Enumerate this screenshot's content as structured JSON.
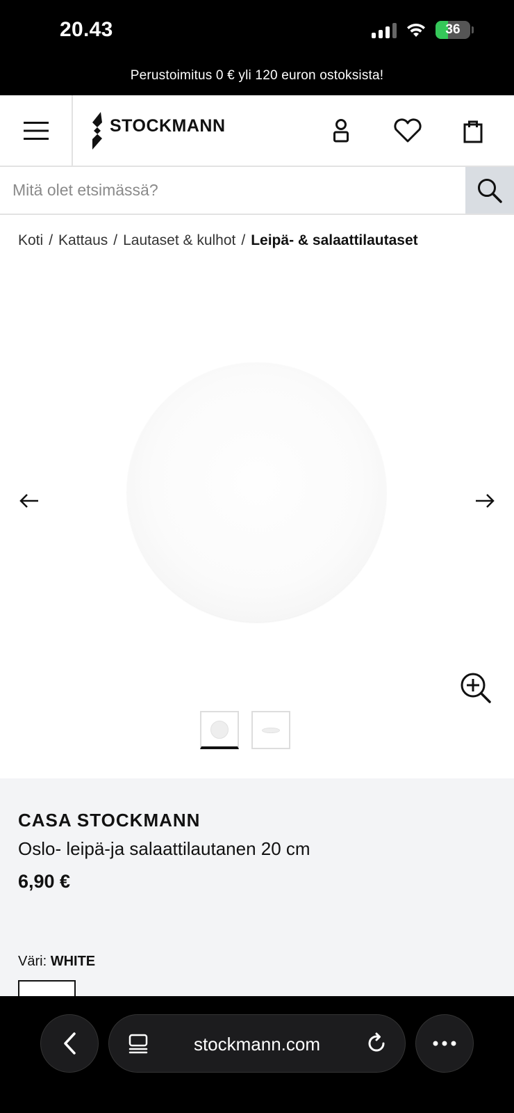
{
  "status_bar": {
    "time": "20.43",
    "battery": "36",
    "battery_level": 0.36
  },
  "promo": {
    "text": "Perustoimitus 0 € yli 120 euron ostoksista!"
  },
  "header": {
    "logo_text": "STOCKMANN",
    "icons": [
      "menu-icon",
      "account-icon",
      "heart-icon",
      "shopping-bag-icon"
    ]
  },
  "search": {
    "placeholder": "Mitä olet etsimässä?",
    "value": ""
  },
  "breadcrumb": {
    "items": [
      "Koti",
      "Kattaus",
      "Lautaset & kulhot"
    ],
    "separator": "/",
    "current": "Leipä- & salaattilautaset"
  },
  "gallery": {
    "thumb_count": 2,
    "active_index": 0
  },
  "product": {
    "brand": "CASA STOCKMANN",
    "name": "Oslo- leipä-ja salaattilautanen 20 cm",
    "price": "6,90 €",
    "color_label": "Väri:",
    "color_value": "WHITE"
  },
  "browser": {
    "url": "stockmann.com"
  },
  "colors": {
    "info_bg": "#f3f4f6",
    "search_button_bg": "#d9dde2",
    "battery_green": "#35c759"
  }
}
